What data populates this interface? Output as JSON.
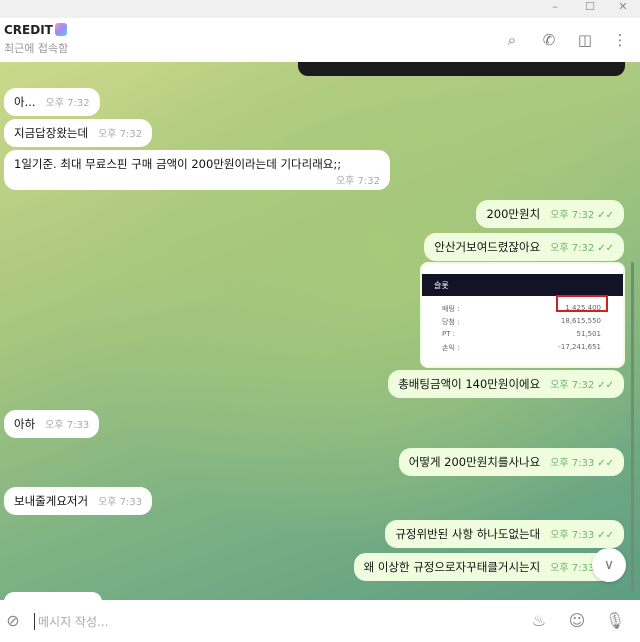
{
  "window": {
    "minimize": "–",
    "maximize": "☐",
    "close": "✕"
  },
  "header": {
    "title": "CREDIT",
    "status": "최근에 접속함"
  },
  "messages": [
    {
      "dir": "in",
      "text": "아...",
      "time": "오후 7:32"
    },
    {
      "dir": "in",
      "text": "지금답장왔는데",
      "time": "오후 7:32"
    },
    {
      "dir": "in",
      "text": "1일기준. 최대 무료스핀 구매 금액이 200만원이라는데 기다리래요;;",
      "time": "오후 7:32"
    },
    {
      "dir": "out",
      "text": "200만원치",
      "time": "오후 7:32"
    },
    {
      "dir": "out",
      "text": "안산거보여드렸잖아요",
      "time": "오후 7:32"
    },
    {
      "dir": "out",
      "text": "총배팅금액이 140만원이에요",
      "time": "오후 7:32"
    },
    {
      "dir": "in",
      "text": "아하",
      "time": "오후 7:33"
    },
    {
      "dir": "out",
      "text": "어떻게 200만원치를사나요",
      "time": "오후 7:33"
    },
    {
      "dir": "in",
      "text": "보내줄게요저거",
      "time": "오후 7:33"
    },
    {
      "dir": "out",
      "text": "규정위반된 사항 하나도없는대",
      "time": "오후 7:33"
    },
    {
      "dir": "out",
      "text": "왜 이상한 규정으로자꾸태클거시는지",
      "time": "오후 7:33"
    }
  ],
  "screenshot": {
    "header": "슬롯",
    "rows": [
      {
        "label": "배팅 :",
        "value": "1,425,400"
      },
      {
        "label": "당첨 :",
        "value": "18,615,550"
      },
      {
        "label": "PT :",
        "value": "51,501"
      },
      {
        "label": "손익 :",
        "value": "-17,241,651"
      }
    ]
  },
  "composer": {
    "placeholder": "메시지 작성..."
  },
  "colors": {
    "outgoing": "#effdde",
    "incoming": "#ffffff",
    "highlight": "#d02020"
  }
}
